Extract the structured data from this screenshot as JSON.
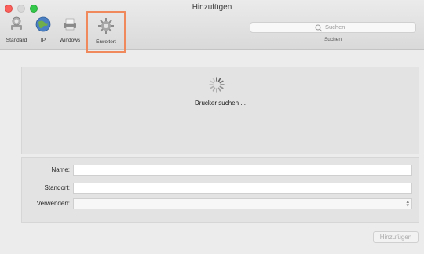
{
  "window": {
    "title": "Hinzufügen"
  },
  "toolbar": {
    "items": [
      {
        "label": "Standard",
        "icon": "printer-standard-icon"
      },
      {
        "label": "IP",
        "icon": "globe-icon"
      },
      {
        "label": "Windows",
        "icon": "printer-windows-icon"
      },
      {
        "label": "Erweitert",
        "icon": "gear-icon",
        "selected": true
      }
    ],
    "search": {
      "placeholder": "Suchen",
      "label": "Suchen"
    }
  },
  "browser": {
    "status": "Drucker suchen ...",
    "icon": "spinner-icon"
  },
  "form": {
    "name_label": "Name:",
    "name_value": "",
    "location_label": "Standort:",
    "location_value": "",
    "use_label": "Verwenden:",
    "use_value": ""
  },
  "actions": {
    "add_label": "Hinzufügen"
  },
  "colors": {
    "highlight": "#f08a5d",
    "close": "#fc605c",
    "maximize": "#34c84a"
  }
}
